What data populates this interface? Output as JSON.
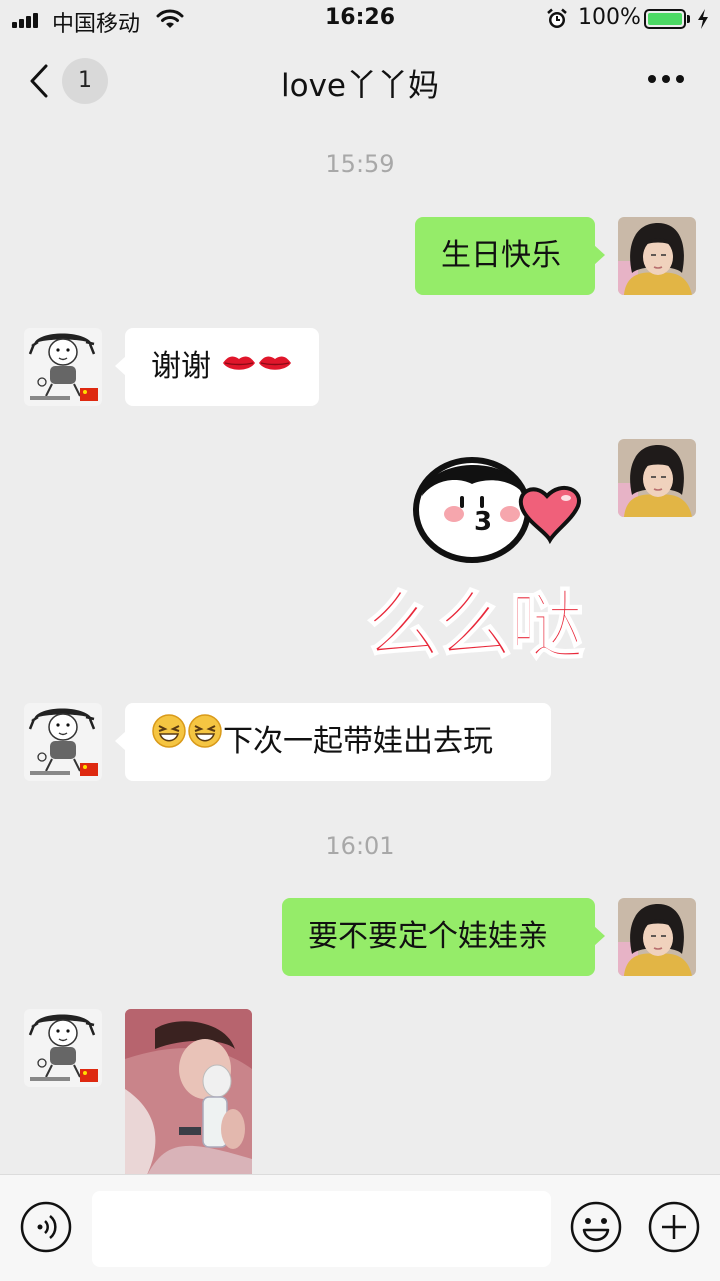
{
  "status_bar": {
    "carrier": "中国移动",
    "time": "16:26",
    "battery_percent": "100%",
    "battery_level": 1.0,
    "icons": [
      "signal-icon",
      "wifi-icon",
      "alarm-icon",
      "battery-icon",
      "charging-icon"
    ]
  },
  "nav": {
    "unread_count": "1",
    "title": "love丫丫妈",
    "icons": [
      "back-icon",
      "more-icon"
    ]
  },
  "messages": [
    {
      "type": "timestamp",
      "text": "15:59"
    },
    {
      "type": "text",
      "side": "sent",
      "text": "生日快乐"
    },
    {
      "type": "text",
      "side": "received",
      "text": "谢谢",
      "emojis": [
        "lips-icon",
        "lips-icon"
      ]
    },
    {
      "type": "sticker",
      "side": "sent",
      "text": "么么哒",
      "sticker": "kiss-face-heart-sticker"
    },
    {
      "type": "text",
      "side": "received",
      "emojis": [
        "grin-squint-icon",
        "grin-squint-icon"
      ],
      "text": "下次一起带娃出去玩"
    },
    {
      "type": "timestamp",
      "text": "16:01"
    },
    {
      "type": "text",
      "side": "sent",
      "text": "要不要定个娃娃亲"
    },
    {
      "type": "image",
      "side": "received",
      "image": "photo-child-with-nebulizer"
    }
  ],
  "input_bar": {
    "value": "",
    "icons": [
      "voice-icon",
      "emoji-icon",
      "plus-icon"
    ]
  },
  "colors": {
    "background": "#ededed",
    "sent_bubble": "#95ec69",
    "received_bubble": "#ffffff",
    "timestamp": "#a8a8a8",
    "sticker_text": "#e8283a"
  }
}
